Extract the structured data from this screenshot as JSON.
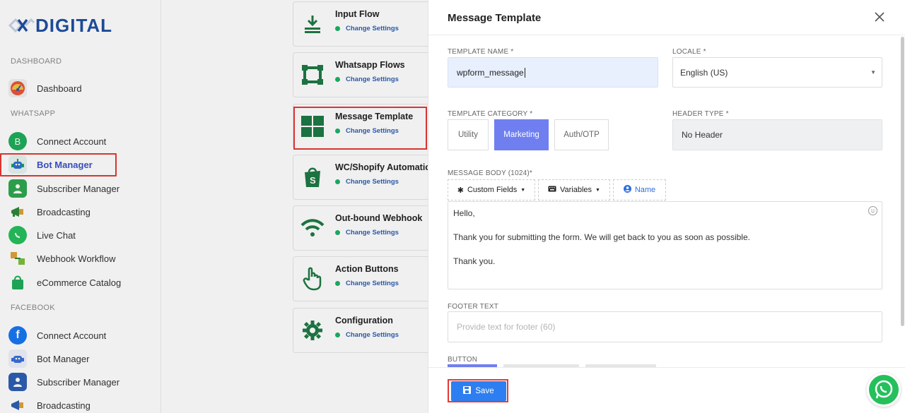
{
  "app": {
    "logo_text": "DIGITAL"
  },
  "sidebar": {
    "sections": [
      {
        "label": "DASHBOARD"
      },
      {
        "label": "WHATSAPP"
      },
      {
        "label": "FACEBOOK"
      }
    ],
    "dashboard_items": [
      {
        "label": "Dashboard",
        "icon": "dashboard-gauge-icon",
        "color": "#e8553b"
      }
    ],
    "whatsapp_items": [
      {
        "label": "Connect Account",
        "icon": "whatsapp-business-icon",
        "color": "#1fae5b"
      },
      {
        "label": "Bot Manager",
        "icon": "robot-icon",
        "color": "#1e9e6a",
        "active": true
      },
      {
        "label": "Subscriber Manager",
        "icon": "subscriber-icon",
        "color": "#2fa84f"
      },
      {
        "label": "Broadcasting",
        "icon": "megaphone-icon",
        "color": "#2d8a3a"
      },
      {
        "label": "Live Chat",
        "icon": "whatsapp-chat-icon",
        "color": "#25c05c"
      },
      {
        "label": "Webhook Workflow",
        "icon": "webhook-icon",
        "color": "#7cbf3a"
      },
      {
        "label": "eCommerce Catalog",
        "icon": "shopping-bag-icon",
        "color": "#1fae5b"
      }
    ],
    "facebook_items": [
      {
        "label": "Connect Account",
        "icon": "facebook-icon",
        "color": "#1877f2"
      },
      {
        "label": "Bot Manager",
        "icon": "robot-icon",
        "color": "#3b6fd8"
      },
      {
        "label": "Subscriber Manager",
        "icon": "subscriber-icon",
        "color": "#2d5fb3"
      },
      {
        "label": "Broadcasting",
        "icon": "megaphone-icon",
        "color": "#2d5fb3"
      }
    ]
  },
  "settings_cards": [
    {
      "title": "Input Flow",
      "sub": "Change Settings",
      "icon": "input-flow-icon"
    },
    {
      "title": "Whatsapp Flows",
      "sub": "Change Settings",
      "icon": "flows-frame-icon"
    },
    {
      "title": "Message Template",
      "sub": "Change Settings",
      "icon": "template-grid-icon"
    },
    {
      "title": "WC/Shopify Automation",
      "sub": "Change Settings",
      "icon": "shopify-bag-icon"
    },
    {
      "title": "Out-bound Webhook",
      "sub": "Change Settings",
      "icon": "wifi-icon"
    },
    {
      "title": "Action Buttons",
      "sub": "Change Settings",
      "icon": "pointer-hand-icon"
    },
    {
      "title": "Configuration",
      "sub": "Change Settings",
      "icon": "gear-icon"
    }
  ],
  "modal": {
    "title": "Message Template",
    "template_name_label": "TEMPLATE NAME *",
    "template_name_value": "wpform_message",
    "locale_label": "LOCALE *",
    "locale_value": "English (US)",
    "category_label": "TEMPLATE CATEGORY *",
    "categories": [
      "Utility",
      "Marketing",
      "Auth/OTP"
    ],
    "selected_category": "Marketing",
    "header_type_label": "HEADER TYPE *",
    "header_type_value": "No Header",
    "body_label": "MESSAGE BODY (1024)*",
    "toolbar": {
      "custom_fields": "Custom Fields",
      "variables": "Variables",
      "name": "Name"
    },
    "body_lines": [
      "Hello,",
      "Thank you for submitting the form. We will get back to you as soon as possible.",
      "Thank you."
    ],
    "footer_label": "FOOTER TEXT",
    "footer_placeholder": "Provide text for footer (60)",
    "button_label": "BUTTON",
    "save_label": "Save"
  },
  "colors": {
    "accent": "#6f7ff0",
    "save": "#2d7ef0",
    "highlight": "#e53935",
    "whatsapp": "#25c05c"
  }
}
